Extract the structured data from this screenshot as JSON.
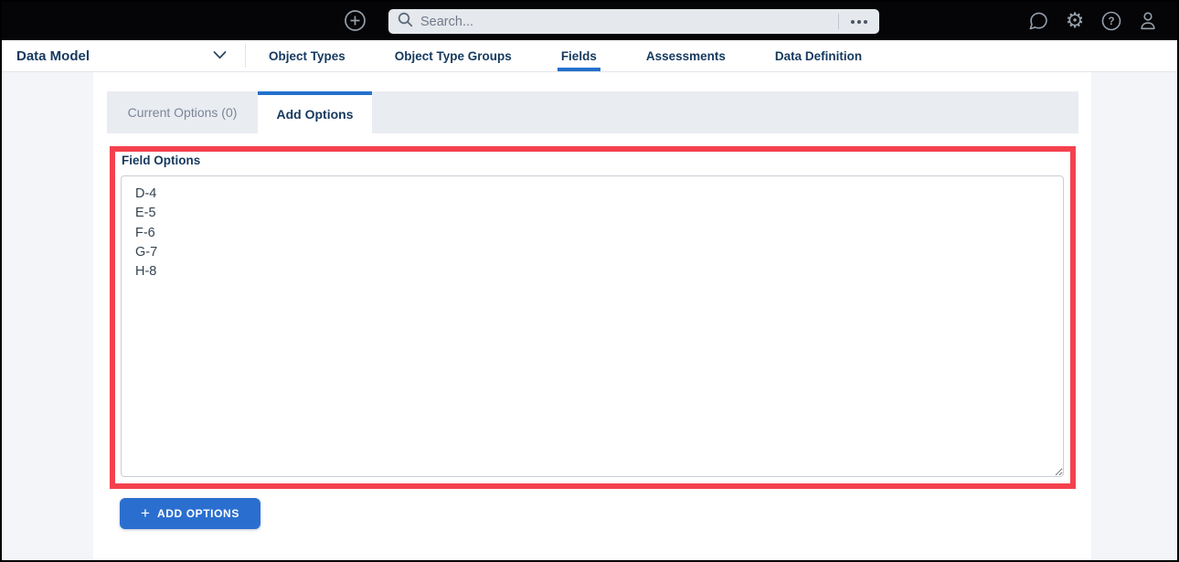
{
  "topbar": {
    "search": {
      "placeholder": "Search..."
    }
  },
  "nav": {
    "title": "Data Model",
    "tabs": [
      {
        "label": "Object Types",
        "active": false
      },
      {
        "label": "Object Type Groups",
        "active": false
      },
      {
        "label": "Fields",
        "active": true
      },
      {
        "label": "Assessments",
        "active": false
      },
      {
        "label": "Data Definition",
        "active": false
      }
    ]
  },
  "subtabs": [
    {
      "label": "Current Options (0)",
      "active": false
    },
    {
      "label": "Add Options",
      "active": true
    }
  ],
  "main": {
    "field_options_label": "Field Options",
    "field_options_value": "D-4\nE-5\nF-6\nG-7\nH-8",
    "add_options_button": "ADD OPTIONS",
    "plus_glyph": "+"
  },
  "icons": {
    "help_glyph": "?",
    "gear_glyph": "⚙"
  },
  "colors": {
    "accent_blue": "#2470CD",
    "button_blue": "#2A6FD0",
    "highlight_red": "#F4414E",
    "navy_text": "#15395E",
    "topbar_bg": "#050507",
    "page_bg": "#F4F5F9",
    "subtab_bg": "#E9ECF1"
  }
}
